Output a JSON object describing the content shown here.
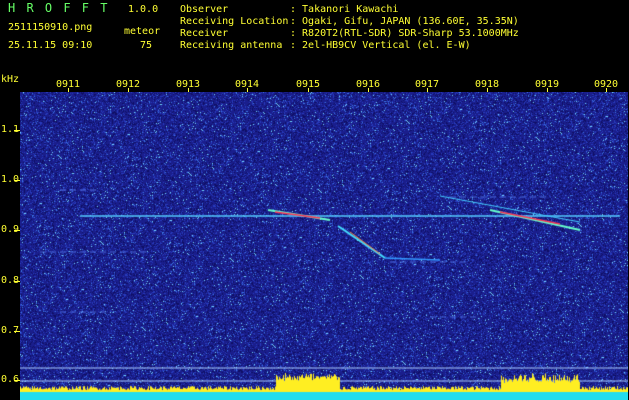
{
  "header": {
    "app_title": "H R O F F T",
    "version": "1.0.0",
    "filename": "2511150910.png",
    "datetime": "25.11.15 09:10",
    "mode_label": "meteor",
    "count": "75",
    "observer_label": "Observer",
    "observer_value": ": Takanori Kawachi",
    "location_label": "Receiving Location",
    "location_value": ": Ogaki, Gifu, JAPAN (136.60E, 35.35N)",
    "receiver_label": "Receiver",
    "receiver_value": ": R820T2(RTL-SDR) SDR-Sharp 53.1000MHz",
    "antenna_label": "Receiving antenna",
    "antenna_value": ": 2el-HB9CV Vertical (el. E-W)"
  },
  "axis": {
    "y_unit": "kHz",
    "x_ticks": [
      "0911",
      "0912",
      "0913",
      "0914",
      "0915",
      "0916",
      "0917",
      "0918",
      "0919",
      "0920"
    ],
    "y_ticks": [
      "1.1",
      "1.0",
      "0.9",
      "0.8",
      "0.7",
      "0.6"
    ]
  },
  "colors": {
    "background": "#000000",
    "spectrogram_base": "#1a1a8c",
    "label": "#ffff33",
    "signal_line": "#33ccff"
  }
}
